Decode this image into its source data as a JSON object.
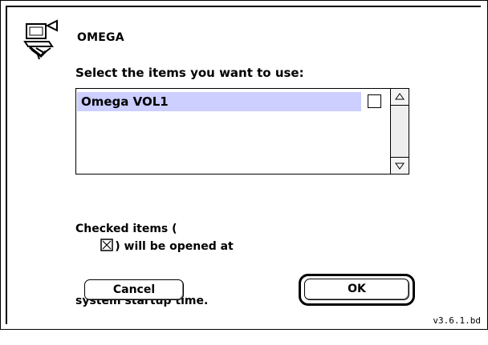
{
  "dialog": {
    "app_name": "OMEGA",
    "prompt": "Select the items you want to use:",
    "list_items": [
      {
        "label": "Omega VOL1",
        "selected": true,
        "checked": false
      }
    ],
    "caption_line1_before": "Checked items (",
    "caption_line1_after": ") will be opened at",
    "caption_line2": "system startup time.",
    "cancel_label": "Cancel",
    "ok_label": "OK",
    "version": "v3.6.1.bd"
  },
  "colors": {
    "selection": "#cccfff",
    "text": "#000000",
    "background": "#ffffff"
  },
  "icons": {
    "app": "computer-startup-icon",
    "checkbox_sample": "checked-box-icon",
    "scroll_up": "up-arrow-icon",
    "scroll_down": "down-arrow-icon"
  }
}
